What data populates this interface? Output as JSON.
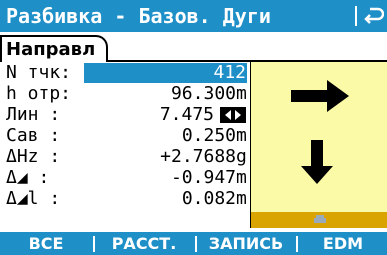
{
  "title": "Разбивка - Базов. Дуги",
  "tab": {
    "label": "Направл"
  },
  "rows": [
    {
      "label": "N тчк:",
      "value": "412",
      "unit": ""
    },
    {
      "label": "h отр:",
      "value": "96.300",
      "unit": "m"
    },
    {
      "label": " Лин  :",
      "value": "7.475",
      "unit": ""
    },
    {
      "label": " Сав  :",
      "value": "0.250",
      "unit": "m"
    },
    {
      "label": "ΔHz  :",
      "value": "+2.7688",
      "unit": "g"
    },
    {
      "label": "Δ◢   :",
      "value": "-0.947",
      "unit": "m"
    },
    {
      "label": "Δ◢l  :",
      "value": "0.082",
      "unit": "m"
    }
  ],
  "softkeys": [
    "ВСЕ",
    "РАССТ.",
    "ЗАПИСЬ",
    "EDM"
  ],
  "colors": {
    "accent": "#1f8fc8",
    "panel": "#fbfaa6",
    "ground": "#d9a400"
  }
}
